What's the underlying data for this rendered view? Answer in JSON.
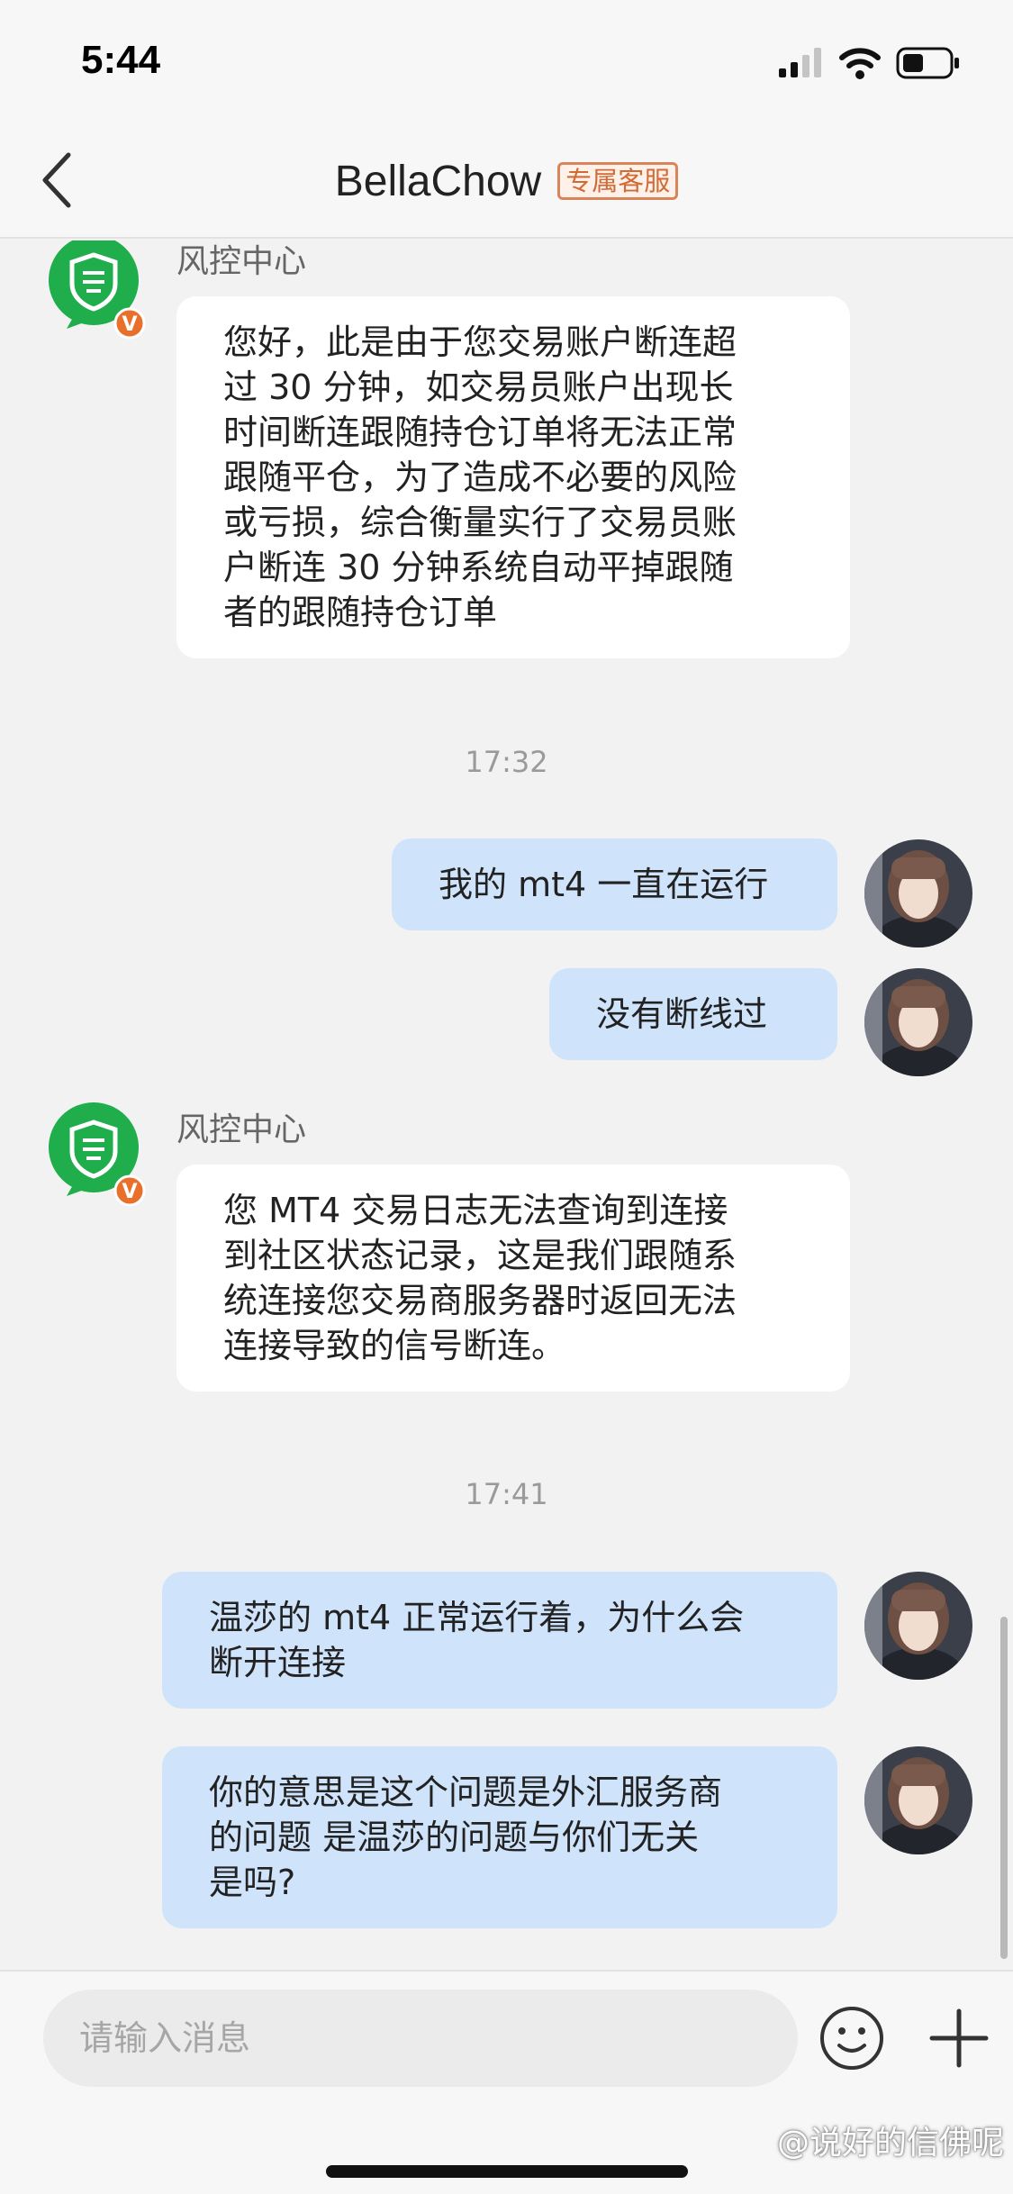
{
  "status_bar": {
    "time": "5:44",
    "icons": [
      "cellular-signal-icon",
      "wifi-icon",
      "battery-icon"
    ]
  },
  "header": {
    "title": "BellaChow",
    "badge": "专属客服",
    "back_icon": "chevron-left-icon"
  },
  "messages": [
    {
      "direction": "incoming",
      "sender": "风控中心",
      "text": "您好，此是由于您交易账户断连超\n过 30 分钟，如交易员账户出现长\n时间断连跟随持仓订单将无法正常\n跟随平仓，为了造成不必要的风险\n或亏损，综合衡量实行了交易员账\n户断连 30 分钟系统自动平掉跟随\n者的跟随持仓订单"
    },
    {
      "type": "timestamp",
      "text": "17:32"
    },
    {
      "direction": "outgoing",
      "text": "我的 mt4 一直在运行"
    },
    {
      "direction": "outgoing",
      "text": "没有断线过"
    },
    {
      "direction": "incoming",
      "sender": "风控中心",
      "text": "您 MT4 交易日志无法查询到连接\n到社区状态记录，这是我们跟随系\n统连接您交易商服务器时返回无法\n连接导致的信号断连。"
    },
    {
      "type": "timestamp",
      "text": "17:41"
    },
    {
      "direction": "outgoing",
      "text": "温莎的 mt4 正常运行着，为什么会\n断开连接"
    },
    {
      "direction": "outgoing",
      "text": "你的意思是这个问题是外汇服务商\n的问题 是温莎的问题与你们无关\n是吗?"
    }
  ],
  "input_bar": {
    "placeholder": "请输入消息",
    "emoji_icon": "emoji-smile-icon",
    "add_icon": "plus-icon"
  },
  "watermark": "@说好的信佛呢",
  "colors": {
    "outgoing_bubble": "#cfe3fa",
    "incoming_bubble": "#ffffff",
    "badge": "#d26a34",
    "official_avatar": "#1fae4b",
    "verified_badge": "#e8702a"
  }
}
